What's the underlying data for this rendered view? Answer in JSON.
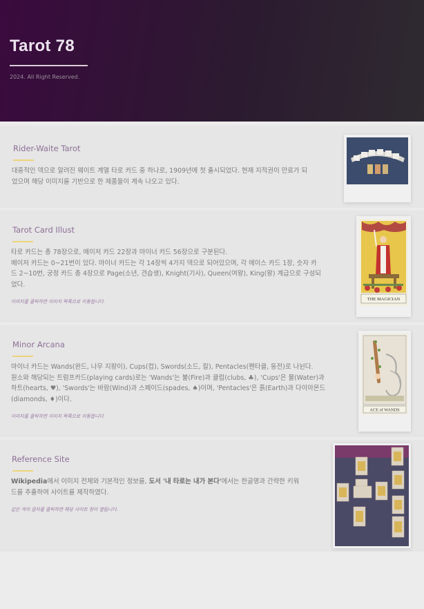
{
  "header": {
    "title": "Tarot 78",
    "copyright": "2024. All Right Reserved."
  },
  "cards": [
    {
      "title": "Rider-Waite Tarot",
      "text_lines": [
        "대중적인 덱으로 알려진 웨이트 계열 타로 카드 중 하나로, 1909년에 첫 출시되었다. 현재 지적권이 만료가 되",
        "었으며 해당 이미지를 기반으로 한 제품들이 계속 나오고 있다."
      ],
      "image": "rider-waite-deck-photo"
    },
    {
      "title": "Tarot Card Illust",
      "text_lines": [
        "타로 카드는 총 78장으로, 메이저 카드 22장과 마이너 카드 56장으로 구분된다.",
        "메이저 카드는 0~21번이 있다. 마이너 카드는 각 14장씩 4가지 덱으로 되어있으며, 각 에이스 카드 1장, 숫자 카",
        "드 2~10번, 궁정 카드 총 4장으로 Page(소년, 견습생), Knight(기사), Queen(여왕), King(왕) 계급으로 구성되",
        "었다."
      ],
      "note": "이미지를 클릭하면 이미지 목록으로 이동합니다.",
      "image": "the-magician-card",
      "image_caption": "THE MAGICIAN"
    },
    {
      "title": "Minor Arcana",
      "text_lines": [
        "마이너 카드는 Wands(완드, 나무 지팡이), Cups(컵), Swords(소드, 칼), Pentacles(펜타클, 동전)로 나뉜다.",
        "원소와 해당되는 트럼프카드(playing cards)로는 'Wands'는 불(Fire)과 클럽(clubs, ♣), 'Cups'은 물(Water)과",
        "하트(hearts, ♥), 'Swords'는 바람(Wind)과 스페이드(spades, ♠)이며, 'Pentacles'은 흙(Earth)과 다이아몬드",
        "(diamonds, ♦)이다."
      ],
      "note": "이미지를 클릭하면 이미지 목록으로 이동합니다.",
      "image": "ace-of-wands-card",
      "image_caption": "ACE of WANDS"
    },
    {
      "title": "Reference Site",
      "text_line1": {
        "bold_a": "Wikipedia",
        "mid": "에서 이미지 전체와 기본적인 정보를, ",
        "bold_b": "도서 '내 타로는 내가 본다'",
        "tail": "에서는 한글명과 간략한 키워"
      },
      "text_line2": "드를 추출하여 사이트를 제작하였다.",
      "note": "같은 색의 글자를 클릭하면 해당 사이트 창이 열립니다.",
      "image": "tarot-spread-photo"
    }
  ]
}
